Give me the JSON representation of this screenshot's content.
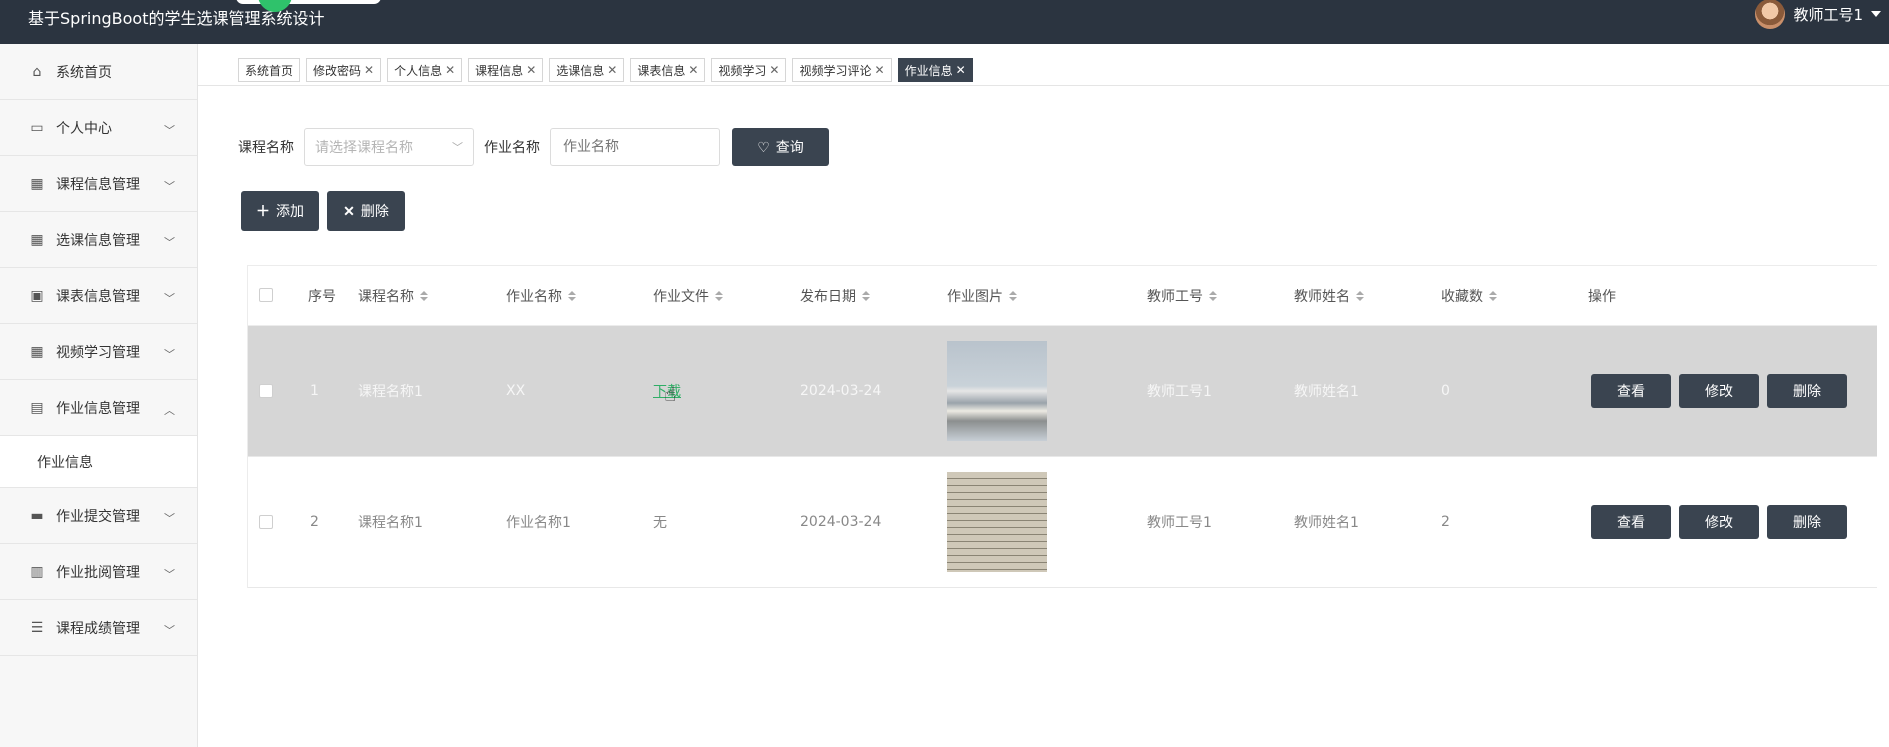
{
  "header": {
    "app_title": "基于SpringBoot的学生选课管理系统设计",
    "user_name": "教师工号1"
  },
  "sidebar": {
    "items": [
      {
        "label": "系统首页",
        "icon": "home-icon",
        "expandable": false
      },
      {
        "label": "个人中心",
        "icon": "card-icon",
        "expandable": true
      },
      {
        "label": "课程信息管理",
        "icon": "grid-icon",
        "expandable": true
      },
      {
        "label": "选课信息管理",
        "icon": "grid-icon",
        "expandable": true
      },
      {
        "label": "课表信息管理",
        "icon": "clipboard-x-icon",
        "expandable": true
      },
      {
        "label": "视频学习管理",
        "icon": "grid-icon",
        "expandable": true
      },
      {
        "label": "作业信息管理",
        "icon": "clipboard-icon",
        "expandable": true,
        "expanded": true
      },
      {
        "label": "作业提交管理",
        "icon": "monitor-icon",
        "expandable": true
      },
      {
        "label": "作业批阅管理",
        "icon": "book-icon",
        "expandable": true
      },
      {
        "label": "课程成绩管理",
        "icon": "list-icon",
        "expandable": true
      }
    ],
    "sub_item": "作业信息"
  },
  "tabs": [
    {
      "label": "系统首页",
      "closable": false,
      "active": false
    },
    {
      "label": "修改密码",
      "closable": true,
      "active": false
    },
    {
      "label": "个人信息",
      "closable": true,
      "active": false
    },
    {
      "label": "课程信息",
      "closable": true,
      "active": false
    },
    {
      "label": "选课信息",
      "closable": true,
      "active": false
    },
    {
      "label": "课表信息",
      "closable": true,
      "active": false
    },
    {
      "label": "视频学习",
      "closable": true,
      "active": false
    },
    {
      "label": "视频学习评论",
      "closable": true,
      "active": false
    },
    {
      "label": "作业信息",
      "closable": true,
      "active": true
    }
  ],
  "search": {
    "course_label": "课程名称",
    "course_placeholder": "请选择课程名称",
    "homework_label": "作业名称",
    "homework_placeholder": "作业名称",
    "query_button": "查询"
  },
  "actions": {
    "add": "添加",
    "delete": "删除"
  },
  "table": {
    "headers": [
      "序号",
      "课程名称",
      "作业名称",
      "作业文件",
      "发布日期",
      "作业图片",
      "教师工号",
      "教师姓名",
      "收藏数",
      "操作"
    ],
    "rows": [
      {
        "index": "1",
        "course": "课程名称1",
        "homework": "XX",
        "file": "下载",
        "date": "2024-03-24",
        "teacher_id": "教师工号1",
        "teacher_name": "教师姓名1",
        "favorites": "0",
        "highlighted": true
      },
      {
        "index": "2",
        "course": "课程名称1",
        "homework": "作业名称1",
        "file": "无",
        "date": "2024-03-24",
        "teacher_id": "教师工号1",
        "teacher_name": "教师姓名1",
        "favorites": "2",
        "highlighted": false
      }
    ],
    "row_actions": {
      "view": "查看",
      "edit": "修改",
      "delete": "删除"
    }
  },
  "colors": {
    "dark": "#2b3440",
    "button": "#3a4450",
    "link": "#2fae66"
  }
}
